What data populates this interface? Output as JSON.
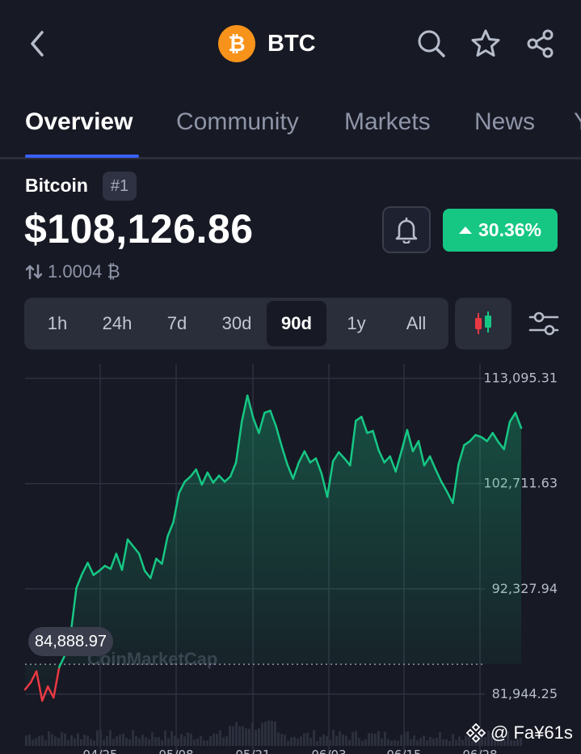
{
  "header": {
    "title": "BTC",
    "logo_glyph": "₿",
    "brand_color": "#F7931A"
  },
  "tabs": [
    {
      "label": "Overview",
      "active": true
    },
    {
      "label": "Community",
      "active": false
    },
    {
      "label": "Markets",
      "active": false
    },
    {
      "label": "News",
      "active": false
    },
    {
      "label": "Y",
      "active": false
    }
  ],
  "coin": {
    "name": "Bitcoin",
    "rank": "#1",
    "price": "$108,126.86",
    "btc_value": "1.0004 ₿"
  },
  "change": {
    "label": "30.36%",
    "color": "#16C784",
    "direction": "up"
  },
  "time_ranges": [
    {
      "label": "1h"
    },
    {
      "label": "24h"
    },
    {
      "label": "7d"
    },
    {
      "label": "30d"
    },
    {
      "label": "90d",
      "active": true
    },
    {
      "label": "1y"
    },
    {
      "label": "All"
    }
  ],
  "icons": {
    "back": "chevron-left-icon",
    "search": "search-icon",
    "star": "star-icon",
    "share": "share-icon",
    "bell": "bell-icon",
    "candles": "candlestick-icon",
    "settings": "sliders-icon"
  },
  "chart_data": {
    "type": "area",
    "y_axis_labels": [
      "113,095.31",
      "102,711.63",
      "92,327.94",
      "81,944.25"
    ],
    "ylim": [
      77000,
      114500
    ],
    "x_labels": [
      "04/25",
      "05/08",
      "05/21",
      "06/03",
      "06/15",
      "06/28"
    ],
    "baseline": "84,888.97",
    "watermark": "CoinMarketCap",
    "colors": {
      "up": "#16C784",
      "down": "#EA3943"
    },
    "series": [
      {
        "values": [
          82400,
          83100,
          84200,
          81300,
          82700,
          81600,
          84600,
          85800,
          87900,
          92400,
          93800,
          94900,
          93700,
          94100,
          94600,
          94300,
          95800,
          94200,
          97200,
          96500,
          95800,
          94100,
          93400,
          95300,
          94800,
          97500,
          98900,
          101800,
          102900,
          103400,
          104100,
          102600,
          103800,
          102800,
          103500,
          102900,
          103400,
          104800,
          108800,
          111400,
          109200,
          107700,
          109700,
          109900,
          108400,
          106400,
          104600,
          103200,
          104800,
          105900,
          104800,
          105200,
          103700,
          101400,
          104900,
          105800,
          105200,
          104500,
          108900,
          109300,
          107700,
          107900,
          106000,
          104800,
          105400,
          103900,
          105900,
          108000,
          105900,
          106900,
          104500,
          105400,
          104100,
          102900,
          101900,
          100800,
          104600,
          106500,
          106900,
          107500,
          107300,
          106900,
          107700,
          106800,
          106100,
          108800,
          109700,
          108200
        ]
      }
    ]
  },
  "watermark_text": "@ Fa¥61s"
}
